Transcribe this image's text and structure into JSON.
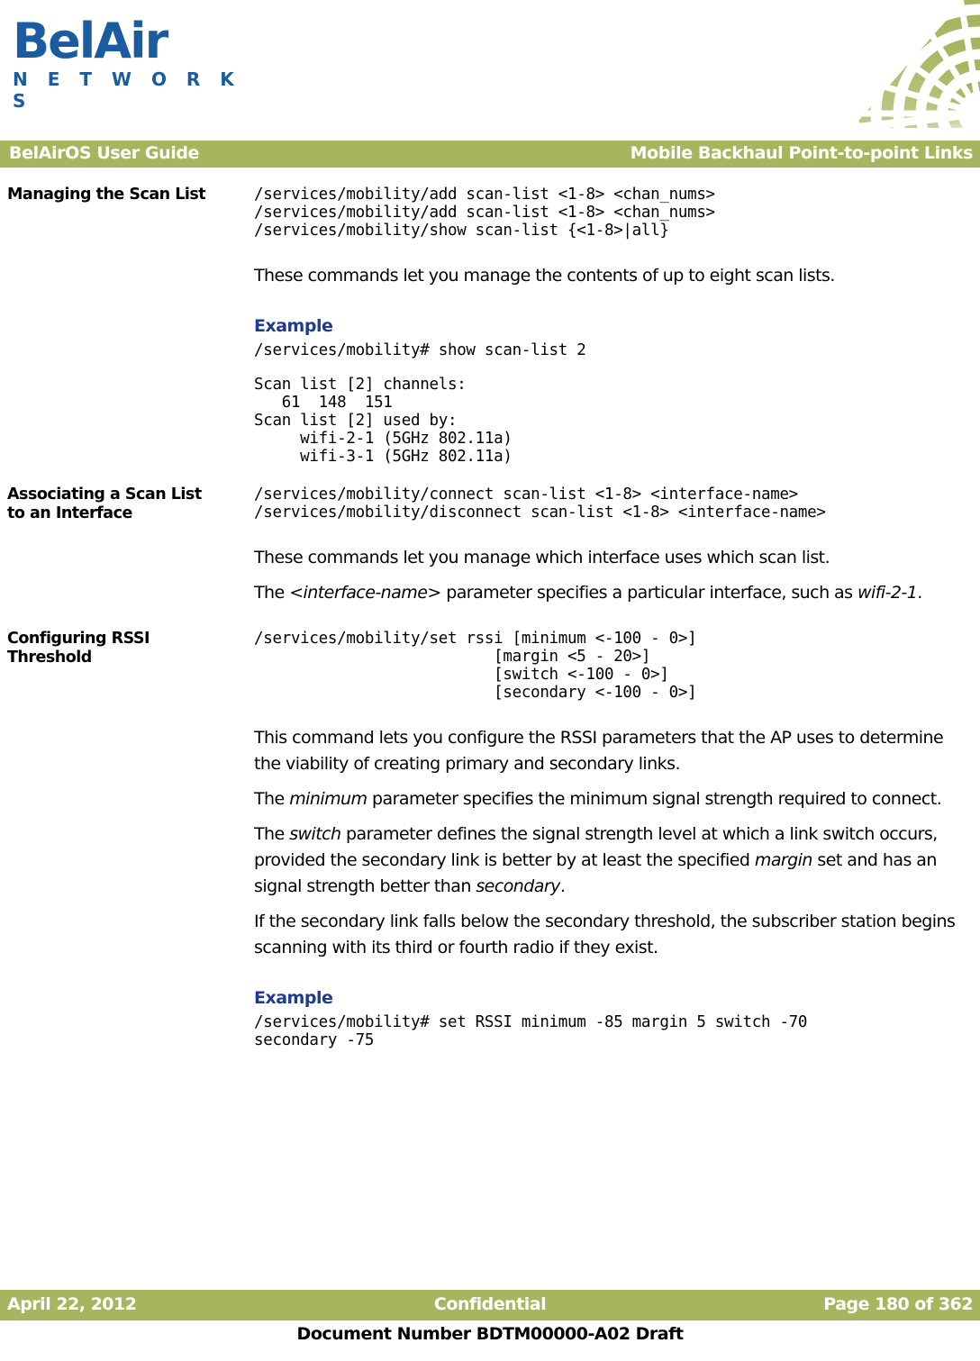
{
  "colors": {
    "brand_blue": "#1B5CA0",
    "olive_bar": "#A9B45F",
    "example_heading_blue": "#1F3C8C",
    "text_black": "#000000"
  },
  "logo": {
    "wordmark": "BelAir",
    "subtitle": "N E T W O R K S"
  },
  "header": {
    "left": "BelAirOS User Guide",
    "right": "Mobile Backhaul Point-to-point Links"
  },
  "sections": [
    {
      "heading": "Managing the Scan List",
      "code_block": "/services/mobility/add scan-list <1-8> <chan_nums>\n/services/mobility/add scan-list <1-8> <chan_nums>\n/services/mobility/show scan-list {<1-8>|all}",
      "paragraph": "These commands let you manage the contents of up to eight scan lists.",
      "example_label": "Example",
      "example_command": "/services/mobility# show scan-list 2",
      "example_output": "Scan list [2] channels:\n   61  148  151\nScan list [2] used by:\n     wifi-2-1 (5GHz 802.11a)\n     wifi-3-1 (5GHz 802.11a)"
    },
    {
      "heading_line1": "Associating a Scan List",
      "heading_line2": "to an Interface",
      "code_block": "/services/mobility/connect scan-list <1-8> <interface-name>\n/services/mobility/disconnect scan-list <1-8> <interface-name>",
      "paragraph1": "These commands let you manage which interface uses which scan list.",
      "paragraph2_pre": "The ",
      "paragraph2_em1": "<interface-name>",
      "paragraph2_mid": " parameter specifies a particular interface, such as ",
      "paragraph2_em2": "wifi-2-1",
      "paragraph2_post": "."
    },
    {
      "heading_line1": "Configuring RSSI",
      "heading_line2": "Threshold",
      "code_block": "/services/mobility/set rssi [minimum <-100 - 0>]\n                          [margin <5 - 20>]\n                          [switch <-100 - 0>]\n                          [secondary <-100 - 0>]",
      "paragraph1": "This command lets you configure the RSSI parameters that the AP uses to determine the viability of creating primary and secondary links.",
      "paragraph2_pre": "The ",
      "paragraph2_em1": "minimum",
      "paragraph2_post": " parameter specifies the minimum signal strength required to connect.",
      "paragraph3_pre": "The ",
      "paragraph3_em1": "switch",
      "paragraph3_mid1": " parameter defines the signal strength level at which a link switch occurs, provided the secondary link is better by at least the specified ",
      "paragraph3_em2": "margin",
      "paragraph3_mid2": " set and has an signal strength better than ",
      "paragraph3_em3": "secondary",
      "paragraph3_post": ".",
      "paragraph4": "If the secondary link falls below the secondary threshold, the subscriber station begins scanning with its third or fourth radio if they exist.",
      "example_label": "Example",
      "example_command": "/services/mobility# set RSSI minimum -85 margin 5 switch -70\nsecondary -75"
    }
  ],
  "footer": {
    "date": "April 22, 2012",
    "classification": "Confidential",
    "page": "Page 180 of 362",
    "document_number": "Document Number BDTM00000-A02 Draft"
  }
}
